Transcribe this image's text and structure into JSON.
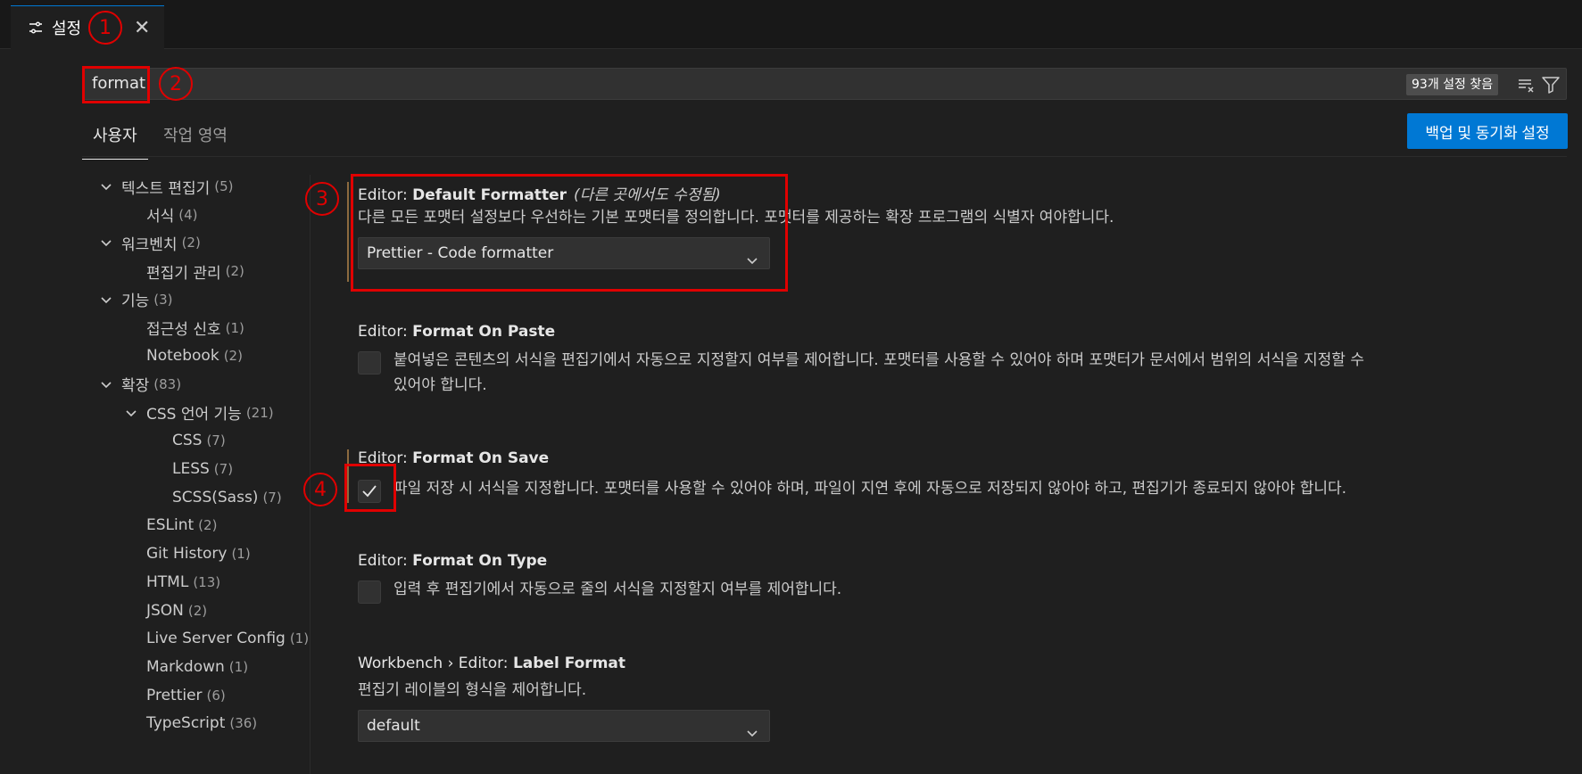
{
  "tab": {
    "title": "설정",
    "close": "✕"
  },
  "search": {
    "value": "format",
    "count": "93개 설정 찾음"
  },
  "scope": {
    "user": "사용자",
    "workspace": "작업 영역",
    "backup_label": "백업 및 동기화 설정"
  },
  "toc": [
    {
      "label": "텍스트 편집기",
      "count": "(5)",
      "expanded": true,
      "level": 0
    },
    {
      "label": "서식",
      "count": "(4)",
      "level": 1
    },
    {
      "label": "워크벤치",
      "count": "(2)",
      "expanded": true,
      "level": 0
    },
    {
      "label": "편집기 관리",
      "count": "(2)",
      "level": 1
    },
    {
      "label": "기능",
      "count": "(3)",
      "expanded": true,
      "level": 0
    },
    {
      "label": "접근성 신호",
      "count": "(1)",
      "level": 1
    },
    {
      "label": "Notebook",
      "count": "(2)",
      "level": 1
    },
    {
      "label": "확장",
      "count": "(83)",
      "expanded": true,
      "level": 0
    },
    {
      "label": "CSS 언어 기능",
      "count": "(21)",
      "expanded": true,
      "level": 1
    },
    {
      "label": "CSS",
      "count": "(7)",
      "level": 2
    },
    {
      "label": "LESS",
      "count": "(7)",
      "level": 2
    },
    {
      "label": "SCSS(Sass)",
      "count": "(7)",
      "level": 2
    },
    {
      "label": "ESLint",
      "count": "(2)",
      "level": 1
    },
    {
      "label": "Git History",
      "count": "(1)",
      "level": 1
    },
    {
      "label": "HTML",
      "count": "(13)",
      "level": 1
    },
    {
      "label": "JSON",
      "count": "(2)",
      "level": 1
    },
    {
      "label": "Live Server Config",
      "count": "(1)",
      "level": 1
    },
    {
      "label": "Markdown",
      "count": "(1)",
      "level": 1
    },
    {
      "label": "Prettier",
      "count": "(6)",
      "level": 1
    },
    {
      "label": "TypeScript",
      "count": "(36)",
      "level": 1
    }
  ],
  "settings": {
    "default_formatter": {
      "category": "Editor: ",
      "name": "Default Formatter",
      "modified": "(다른 곳에서도 수정됨)",
      "description": "다른 모든 포맷터 설정보다 우선하는 기본 포맷터를 정의합니다. 포맷터를 제공하는 확장 프로그램의 식별자 여야합니다.",
      "value": "Prettier - Code formatter"
    },
    "format_on_paste": {
      "category": "Editor: ",
      "name": "Format On Paste",
      "description_line1": "붙여넣은 콘텐츠의 서식을 편집기에서 자동으로 지정할지 여부를 제어합니다. 포맷터를 사용할 수 있어야 하며 포맷터가 문서에서 범위의 서식을 지정할 수",
      "description_line2": "있어야 합니다.",
      "checked": false
    },
    "format_on_save": {
      "category": "Editor: ",
      "name": "Format On Save",
      "description": "파일 저장 시 서식을 지정합니다. 포맷터를 사용할 수 있어야 하며, 파일이 지연 후에 자동으로 저장되지 않아야 하고, 편집기가 종료되지 않아야 합니다.",
      "checked": true
    },
    "format_on_type": {
      "category": "Editor: ",
      "name": "Format On Type",
      "description": "입력 후 편집기에서 자동으로 줄의 서식을 지정할지 여부를 제어합니다.",
      "checked": false
    },
    "label_format": {
      "category": "Workbench › Editor: ",
      "name": "Label Format",
      "description": "편집기 레이블의 형식을 제어합니다.",
      "value": "default"
    }
  },
  "annotations": [
    "1",
    "2",
    "3",
    "4"
  ],
  "colors": {
    "accent": "#0078d4",
    "annotation": "#e00000",
    "background": "#1f1f1f"
  },
  "icons": [
    "settings-sliders-icon",
    "close-icon",
    "clear-filter-icon",
    "filter-icon",
    "chevron-down-icon",
    "check-icon"
  ]
}
